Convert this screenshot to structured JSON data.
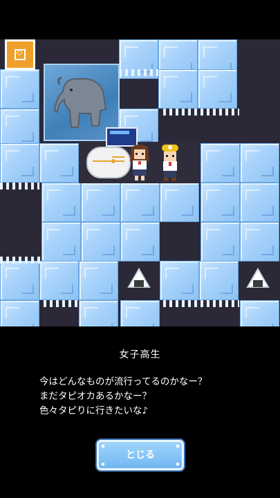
{
  "dialog": {
    "speaker": "女子高生",
    "lines": [
      "今はどんなものが流行ってるのかなー？",
      "まだタピオカあるかなー？",
      "色々タピりに行きたいな♪"
    ],
    "close_label": "とじる"
  },
  "colors": {
    "ice": "#a9d3fb",
    "ice_edge": "#6aa6e0",
    "cave": "#2b2837",
    "menu_button": "#f0a02a",
    "close_button": "#71b7f2"
  },
  "icons": [
    "menu-icon",
    "elephant-frozen-sprite",
    "capsule-machine",
    "schoolgirl-sprite",
    "miner-sprite",
    "onigiri-item"
  ]
}
